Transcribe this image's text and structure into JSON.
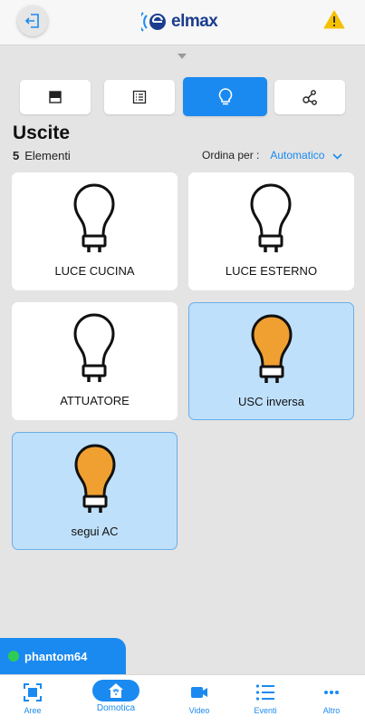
{
  "header": {
    "logo_text": "elmax",
    "back_icon": "logout-icon",
    "alert_icon": "warning-icon"
  },
  "tabs": [
    {
      "name": "shutter-icon",
      "active": false
    },
    {
      "name": "list-icon",
      "active": false
    },
    {
      "name": "bulb-icon",
      "active": true
    },
    {
      "name": "scenario-icon",
      "active": false
    }
  ],
  "section": {
    "title": "Uscite",
    "count": "5",
    "count_label": "Elementi",
    "sort_label": "Ordina per :",
    "sort_value": "Automatico"
  },
  "outputs": [
    {
      "label": "LUCE CUCINA",
      "on": false
    },
    {
      "label": "LUCE ESTERNO",
      "on": false
    },
    {
      "label": "ATTUATORE",
      "on": false
    },
    {
      "label": "USC inversa",
      "on": true
    },
    {
      "label": "segui AC",
      "on": true
    }
  ],
  "user": {
    "name": "phantom64",
    "status_color": "#2ecc57"
  },
  "nav": [
    {
      "label": "Aree",
      "icon": "areas-icon",
      "active": false
    },
    {
      "label": "Domotica",
      "icon": "home-automation-icon",
      "active": true
    },
    {
      "label": "Video",
      "icon": "video-icon",
      "active": false
    },
    {
      "label": "Eventi",
      "icon": "events-list-icon",
      "active": false
    },
    {
      "label": "Altro",
      "icon": "more-icon",
      "active": false
    }
  ],
  "colors": {
    "accent": "#1a8af0",
    "bulb_on": "#f0a030",
    "tile_on": "#bfe0fb",
    "background": "#e4e4e4"
  }
}
